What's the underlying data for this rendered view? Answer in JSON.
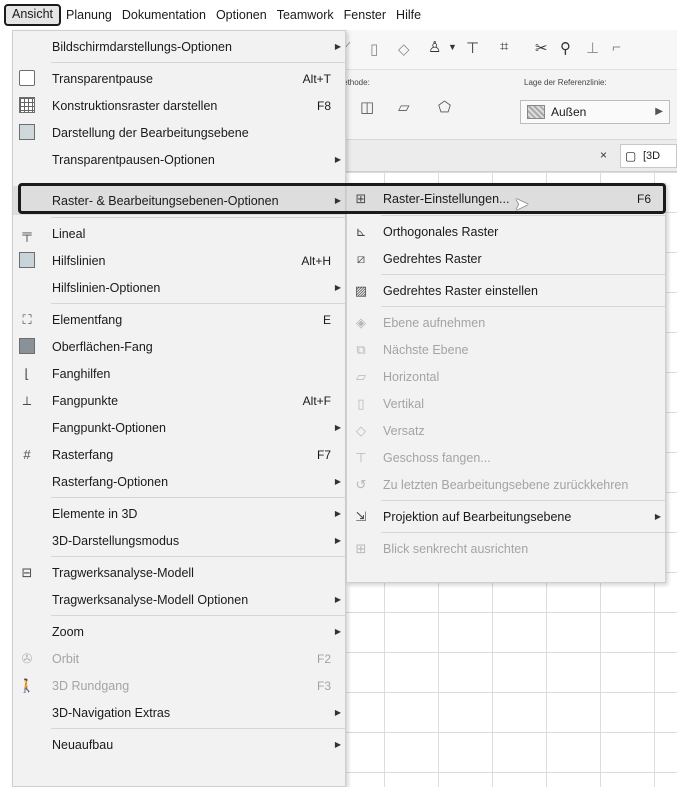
{
  "menubar": {
    "items": [
      "Ansicht",
      "Planung",
      "Dokumentation",
      "Optionen",
      "Teamwork",
      "Fenster",
      "Hilfe"
    ]
  },
  "toolbar": {
    "method_label": "emethode:",
    "ref_label": "Lage der Referenzlinie:",
    "ref_value": "Außen",
    "tab_label": "[3D"
  },
  "menu": {
    "items": [
      {
        "label": "Bildschirmdarstellungs-Optionen",
        "shortcut": "",
        "submenu": true,
        "disabled": false,
        "icon": ""
      },
      {
        "label": "Transparentpause",
        "shortcut": "Alt+T",
        "submenu": false,
        "disabled": false,
        "icon": "transparency-icon"
      },
      {
        "label": "Konstruktionsraster darstellen",
        "shortcut": "F8",
        "submenu": false,
        "disabled": false,
        "icon": "grid-icon"
      },
      {
        "label": "Darstellung der Bearbeitungsebene",
        "shortcut": "",
        "submenu": false,
        "disabled": false,
        "icon": "editing-plane-icon"
      },
      {
        "label": "Transparentpausen-Optionen",
        "shortcut": "",
        "submenu": true,
        "disabled": false,
        "icon": ""
      },
      {
        "label": "Raster- & Bearbeitungsebenen-Optionen",
        "shortcut": "",
        "submenu": true,
        "disabled": false,
        "icon": ""
      },
      {
        "label": "Lineal",
        "shortcut": "",
        "submenu": false,
        "disabled": false,
        "icon": "ruler-icon"
      },
      {
        "label": "Hilfslinien",
        "shortcut": "Alt+H",
        "submenu": false,
        "disabled": false,
        "icon": "guide-lines-icon"
      },
      {
        "label": "Hilfslinien-Optionen",
        "shortcut": "",
        "submenu": true,
        "disabled": false,
        "icon": ""
      },
      {
        "label": "Elementfang",
        "shortcut": "E",
        "submenu": false,
        "disabled": false,
        "icon": "element-snap-icon"
      },
      {
        "label": "Oberflächen-Fang",
        "shortcut": "",
        "submenu": false,
        "disabled": false,
        "icon": "surface-snap-icon"
      },
      {
        "label": "Fanghilfen",
        "shortcut": "",
        "submenu": false,
        "disabled": false,
        "icon": "snap-guides-icon"
      },
      {
        "label": "Fangpunkte",
        "shortcut": "Alt+F",
        "submenu": false,
        "disabled": false,
        "icon": "snap-points-icon"
      },
      {
        "label": "Fangpunkt-Optionen",
        "shortcut": "",
        "submenu": true,
        "disabled": false,
        "icon": ""
      },
      {
        "label": "Rasterfang",
        "shortcut": "F7",
        "submenu": false,
        "disabled": false,
        "icon": "grid-snap-icon"
      },
      {
        "label": "Rasterfang-Optionen",
        "shortcut": "",
        "submenu": true,
        "disabled": false,
        "icon": ""
      },
      {
        "label": "Elemente in 3D",
        "shortcut": "",
        "submenu": true,
        "disabled": false,
        "icon": ""
      },
      {
        "label": "3D-Darstellungsmodus",
        "shortcut": "",
        "submenu": true,
        "disabled": false,
        "icon": ""
      },
      {
        "label": "Tragwerksanalyse-Modell",
        "shortcut": "",
        "submenu": false,
        "disabled": false,
        "icon": "structural-model-icon"
      },
      {
        "label": "Tragwerksanalyse-Modell Optionen",
        "shortcut": "",
        "submenu": true,
        "disabled": false,
        "icon": ""
      },
      {
        "label": "Zoom",
        "shortcut": "",
        "submenu": true,
        "disabled": false,
        "icon": ""
      },
      {
        "label": "Orbit",
        "shortcut": "F2",
        "submenu": false,
        "disabled": true,
        "icon": "orbit-icon"
      },
      {
        "label": "3D Rundgang",
        "shortcut": "F3",
        "submenu": false,
        "disabled": true,
        "icon": "walk-icon"
      },
      {
        "label": "3D-Navigation Extras",
        "shortcut": "",
        "submenu": true,
        "disabled": false,
        "icon": ""
      },
      {
        "label": "Neuaufbau",
        "shortcut": "",
        "submenu": true,
        "disabled": false,
        "icon": ""
      }
    ]
  },
  "submenu": {
    "items": [
      {
        "label": "Raster-Einstellungen...",
        "shortcut": "F6",
        "submenu": false,
        "disabled": false,
        "icon": "grid-settings-icon"
      },
      {
        "label": "Orthogonales Raster",
        "shortcut": "",
        "submenu": false,
        "disabled": false,
        "icon": "orthogonal-grid-icon"
      },
      {
        "label": "Gedrehtes Raster",
        "shortcut": "",
        "submenu": false,
        "disabled": false,
        "icon": "rotated-grid-icon"
      },
      {
        "label": "Gedrehtes Raster einstellen",
        "shortcut": "",
        "submenu": false,
        "disabled": false,
        "icon": "set-rotated-grid-icon"
      },
      {
        "label": "Ebene aufnehmen",
        "shortcut": "",
        "submenu": false,
        "disabled": true,
        "icon": "pick-plane-icon"
      },
      {
        "label": "Nächste Ebene",
        "shortcut": "",
        "submenu": false,
        "disabled": true,
        "icon": "next-plane-icon"
      },
      {
        "label": "Horizontal",
        "shortcut": "",
        "submenu": false,
        "disabled": true,
        "icon": "horizontal-plane-icon"
      },
      {
        "label": "Vertikal",
        "shortcut": "",
        "submenu": false,
        "disabled": true,
        "icon": "vertical-plane-icon"
      },
      {
        "label": "Versatz",
        "shortcut": "",
        "submenu": false,
        "disabled": true,
        "icon": "offset-icon"
      },
      {
        "label": "Geschoss fangen...",
        "shortcut": "",
        "submenu": false,
        "disabled": true,
        "icon": "story-snap-icon"
      },
      {
        "label": "Zu letzten Bearbeitungsebene zurückkehren",
        "shortcut": "",
        "submenu": false,
        "disabled": true,
        "icon": "return-plane-icon"
      },
      {
        "label": "Projektion auf Bearbeitungsebene",
        "shortcut": "",
        "submenu": true,
        "disabled": false,
        "icon": "projection-icon"
      },
      {
        "label": "Blick senkrecht ausrichten",
        "shortcut": "",
        "submenu": false,
        "disabled": true,
        "icon": "align-view-icon"
      }
    ]
  }
}
